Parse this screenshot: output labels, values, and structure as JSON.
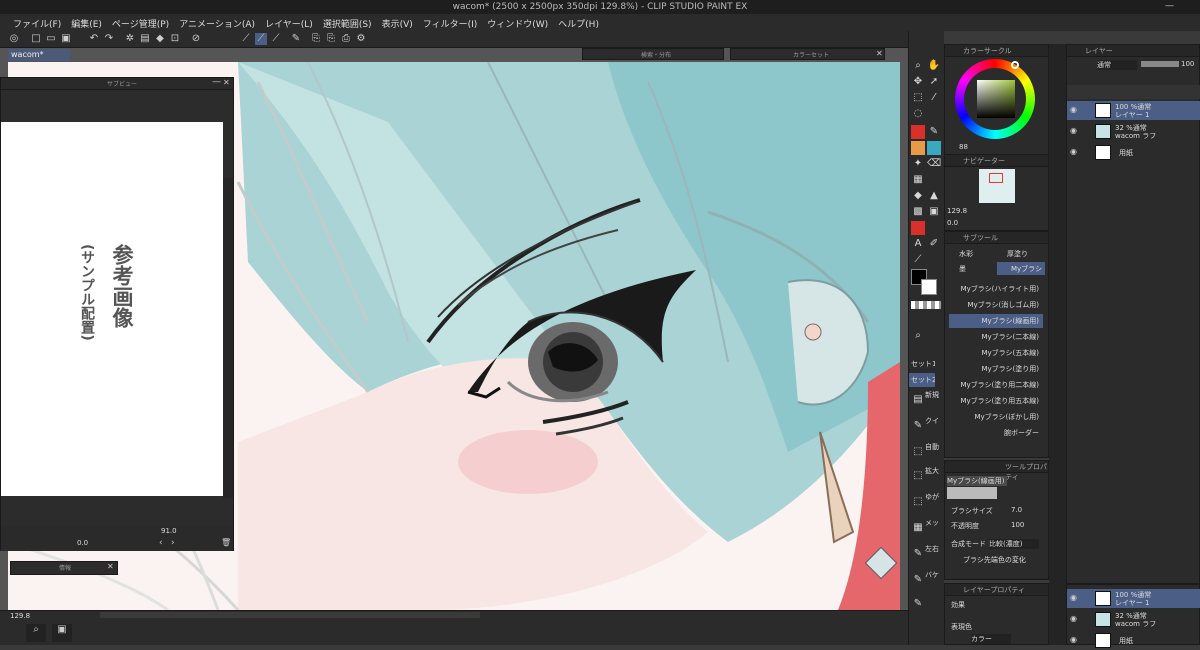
{
  "window": {
    "title": "wacom* (2500 x 2500px 350dpi 129.8%) - CLIP STUDIO PAINT EX"
  },
  "menu": [
    "ファイル(F)",
    "編集(E)",
    "ページ管理(P)",
    "アニメーション(A)",
    "レイヤー(L)",
    "選択範囲(S)",
    "表示(V)",
    "フィルター(I)",
    "ウィンドウ(W)",
    "ヘルプ(H)"
  ],
  "document": {
    "tab": "wacom*"
  },
  "panels": {
    "subview_title": "サブビュー",
    "subview_text": "参考画像",
    "subview_subtext": "(サンプル配置)",
    "subview_zoom": "91.0",
    "subview_angle": "0.0",
    "info_title": "情報",
    "search_tab": "検索・分布",
    "colorset_tab": "カラーセット",
    "color_circle": "カラーサークル",
    "navigator": "ナビゲーター",
    "nav_zoom": "129.8",
    "nav_angle": "0.0",
    "subtool": "サブツール",
    "tool_property": "ツールプロパティ",
    "layer_property": "レイヤープロパティ",
    "layer": "レイヤー",
    "hsv_readout": "88"
  },
  "subtool_groups": [
    "水彩",
    "厚塗り",
    "墨",
    "Myブラシ"
  ],
  "brushes": [
    "Myブラシ(ハイライト用)",
    "Myブラシ(消しゴム用)",
    "Myブラシ(線画用)",
    "Myブラシ(二本線)",
    "Myブラシ(五本線)",
    "Myブラシ(塗り用)",
    "Myブラシ(塗り用二本線)",
    "Myブラシ(塗り用五本線)",
    "Myブラシ(ぼかし用)",
    "腕ボーダー"
  ],
  "selected_brush_index": 2,
  "tool_property": {
    "current": "Myブラシ(線画用)",
    "size_label": "ブラシサイズ",
    "size_value": "7.0",
    "opacity_label": "不透明度",
    "opacity_value": "100",
    "blend_label": "合成モード",
    "blend_value": "比較(濃度)",
    "tip_label": "ブラシ先端色の変化"
  },
  "layer_property": {
    "effect": "効果",
    "expression": "表現色",
    "color": "カラー"
  },
  "layers": {
    "blend": "通常",
    "opacity": "100",
    "rows": [
      {
        "percent": "100 %通常",
        "name": "レイヤー 1",
        "selected": true
      },
      {
        "percent": "32 %通常",
        "name": "wacom ラフ",
        "selected": false
      },
      {
        "percent": "",
        "name": "用紙",
        "selected": false
      }
    ]
  },
  "left_toolbar": {
    "set1": "セット1",
    "set2": "セット2",
    "labels": [
      "新規",
      "クイ",
      "自動",
      "拡大",
      "ゆが",
      "メッ",
      "左右",
      "バケ"
    ]
  },
  "status": {
    "zoom": "129.8"
  },
  "colors": {
    "main": "#000000",
    "sub": "#ffffff",
    "accent": "#4b5e86",
    "red_tool": "#d9302c"
  }
}
